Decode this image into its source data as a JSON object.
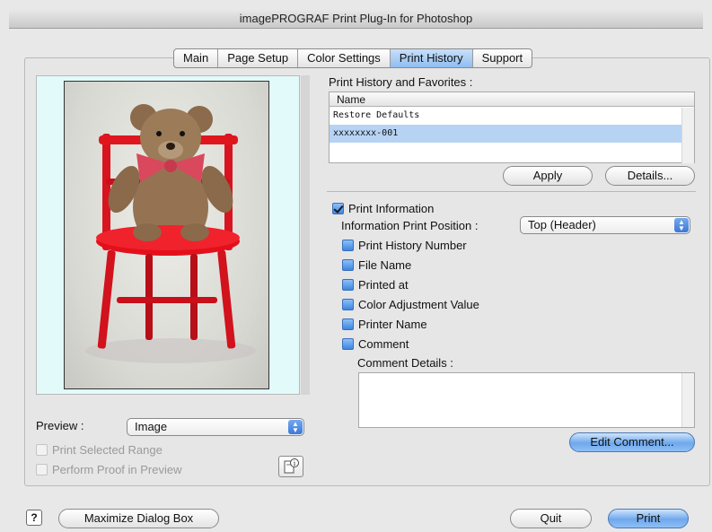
{
  "window": {
    "title": "imagePROGRAF Print Plug-In for Photoshop"
  },
  "tabs": [
    {
      "label": "Main",
      "active": false
    },
    {
      "label": "Page Setup",
      "active": false
    },
    {
      "label": "Color Settings",
      "active": false
    },
    {
      "label": "Print History",
      "active": true
    },
    {
      "label": "Support",
      "active": false
    }
  ],
  "preview_panel": {
    "preview_label": "Preview :",
    "preview_value": "Image",
    "print_selected_range": "Print Selected Range",
    "perform_proof": "Perform Proof in Preview"
  },
  "history": {
    "section_label": "Print History and Favorites :",
    "column_name": "Name",
    "rows": [
      "Restore Defaults",
      "xxxxxxxx-001"
    ],
    "selected_row": "xxxxxxxx-001",
    "apply_label": "Apply",
    "details_label": "Details..."
  },
  "print_info": {
    "print_information_label": "Print Information",
    "print_information_checked": true,
    "position_label": "Information Print Position :",
    "position_value": "Top (Header)",
    "options": [
      "Print History Number",
      "File Name",
      "Printed at",
      "Color Adjustment Value",
      "Printer Name",
      "Comment"
    ],
    "comment_details_label": "Comment Details :",
    "edit_comment_label": "Edit Comment..."
  },
  "footer": {
    "help_label": "?",
    "maximize_label": "Maximize Dialog Box",
    "quit_label": "Quit",
    "print_label": "Print"
  },
  "colors": {
    "accent": "#6fa8ec",
    "preview_bg": "#e2fafa",
    "selection": "#b7d3f4"
  }
}
